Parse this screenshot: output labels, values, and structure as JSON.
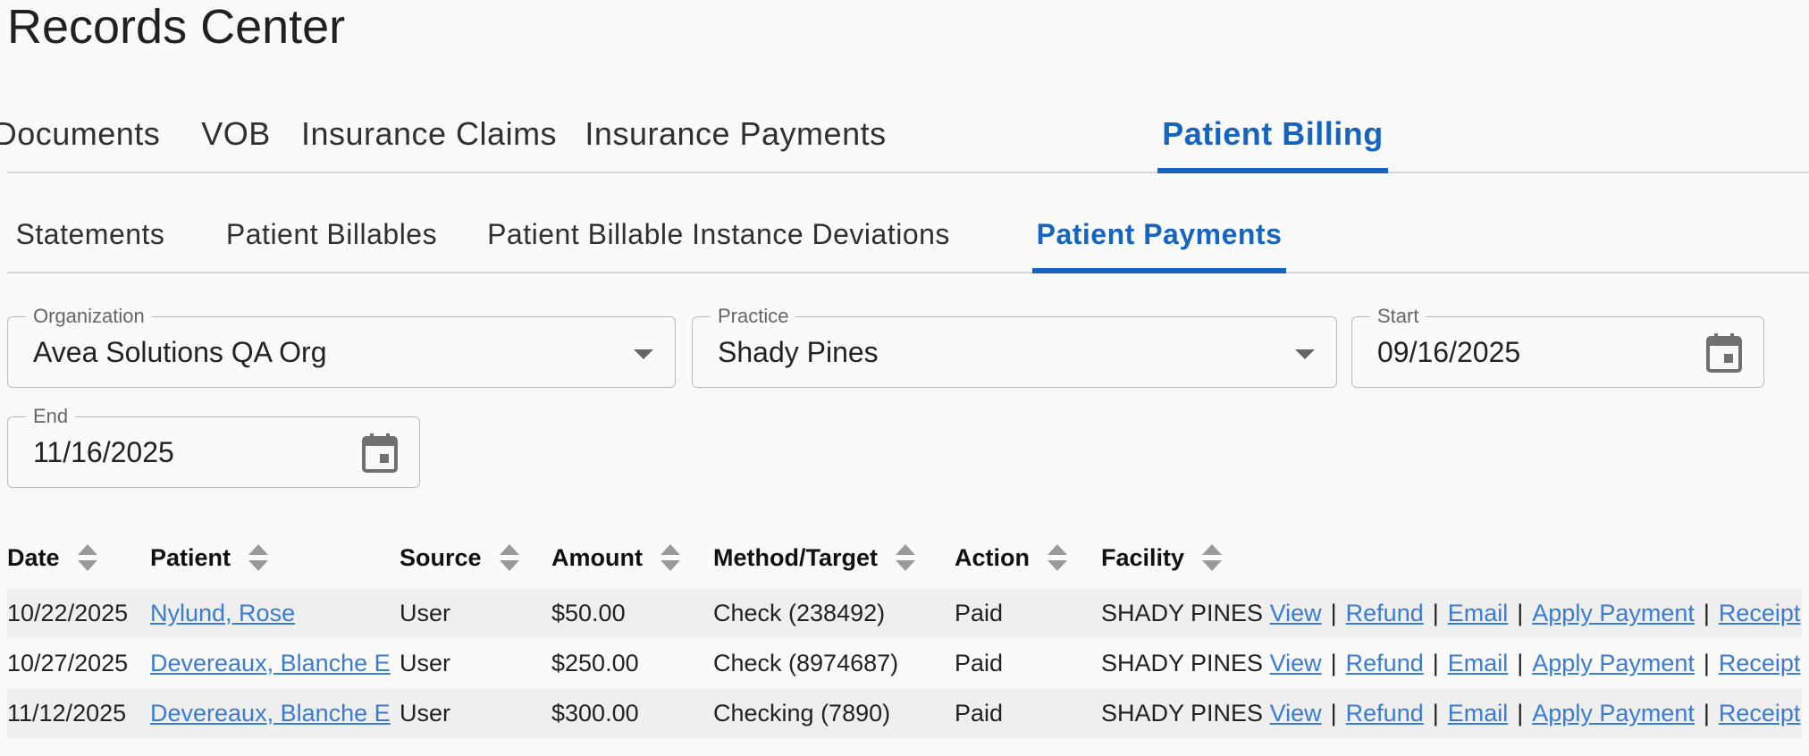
{
  "page": {
    "title": "Records Center"
  },
  "main_tabs": [
    "Documents",
    "VOB",
    "Insurance Claims",
    "Insurance Payments",
    "Patient Billing"
  ],
  "main_active": "Patient Billing",
  "sub_tabs": [
    "Statements",
    "Patient Billables",
    "Patient Billable Instance Deviations",
    "Patient Payments"
  ],
  "sub_active": "Patient Payments",
  "filters": {
    "organization": {
      "label": "Organization",
      "value": "Avea Solutions QA Org"
    },
    "practice": {
      "label": "Practice",
      "value": "Shady Pines"
    },
    "start": {
      "label": "Start",
      "value": "09/16/2025"
    },
    "end": {
      "label": "End",
      "value": "11/16/2025"
    }
  },
  "table": {
    "columns": [
      "Date",
      "Patient",
      "Source",
      "Amount",
      "Method/Target",
      "Action",
      "Facility"
    ],
    "rows": [
      {
        "date": "10/22/2025",
        "patient": "Nylund, Rose",
        "source": "User",
        "amount": "$50.00",
        "method": "Check (238492)",
        "action": "Paid",
        "facility": "SHADY PINES"
      },
      {
        "date": "10/27/2025",
        "patient": "Devereaux, Blanche E",
        "source": "User",
        "amount": "$250.00",
        "method": "Check (8974687)",
        "action": "Paid",
        "facility": "SHADY PINES"
      },
      {
        "date": "11/12/2025",
        "patient": "Devereaux, Blanche E",
        "source": "User",
        "amount": "$300.00",
        "method": "Checking (7890)",
        "action": "Paid",
        "facility": "SHADY PINES"
      }
    ],
    "row_actions": [
      "View",
      "Refund",
      "Email",
      "Apply Payment",
      "Receipt"
    ],
    "separator": "|"
  },
  "colors": {
    "accent": "#1565c0",
    "link": "#3a7bd5",
    "row_stripe": "#efefef"
  },
  "icons": {
    "dropdown": "chevron-down-icon",
    "date": "calendar-icon",
    "sort": "sort-icon"
  }
}
